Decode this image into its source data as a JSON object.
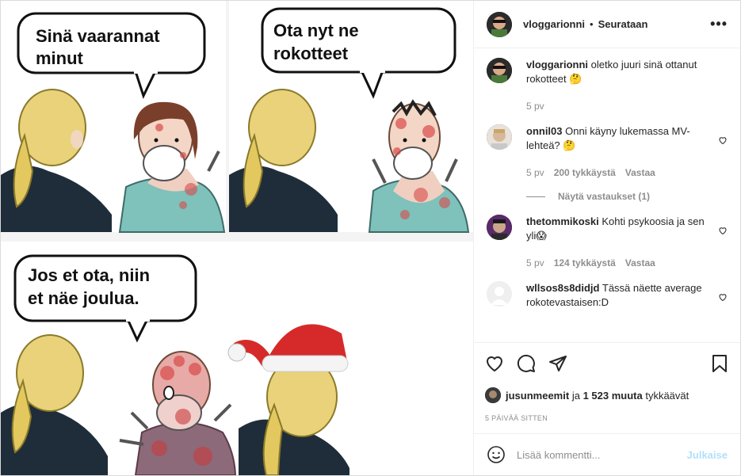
{
  "post": {
    "author": "vloggarionni",
    "follow_status": "Seurataan",
    "more": "•••"
  },
  "meme": {
    "bubble1_line1": "Sinä vaarannat",
    "bubble1_line2": "minut",
    "bubble2_line1": "Ota nyt ne",
    "bubble2_line2": "rokotteet",
    "bubble3_line1": "Jos et ota, niin",
    "bubble3_line2": "et näe joulua."
  },
  "caption": {
    "username": "vloggarionni",
    "text": "oletko juuri sinä ottanut rokotteet 🤔",
    "time": "5 pv"
  },
  "comments": [
    {
      "username": "onnil03",
      "text": "Onni käyny lukemassa MV-lehteä? 🤔",
      "time": "5 pv",
      "likes": "200 tykkäystä",
      "reply": "Vastaa"
    },
    {
      "username": "thetommikoski",
      "text": "Kohti psykoosia ja sen yli😱",
      "time": "5 pv",
      "likes": "124 tykkäystä",
      "reply": "Vastaa"
    },
    {
      "username": "wllsos8s8didjd",
      "text": "Tässä näette average rokotevastaisen:D"
    }
  ],
  "view_replies": "Näytä vastaukset (1)",
  "likes_summary": {
    "user": "jusunmeemit",
    "middle": "ja",
    "count": "1 523 muuta",
    "end": "tykkäävät"
  },
  "timestamp": "5 PÄIVÄÄ SITTEN",
  "add_comment": {
    "placeholder": "Lisää kommentti...",
    "post_label": "Julkaise"
  },
  "icons": {
    "like": "heart-icon",
    "comment": "comment-bubble-icon",
    "share": "paper-plane-icon",
    "save": "bookmark-icon",
    "emoji": "smiley-icon",
    "more": "more-dots-icon"
  }
}
